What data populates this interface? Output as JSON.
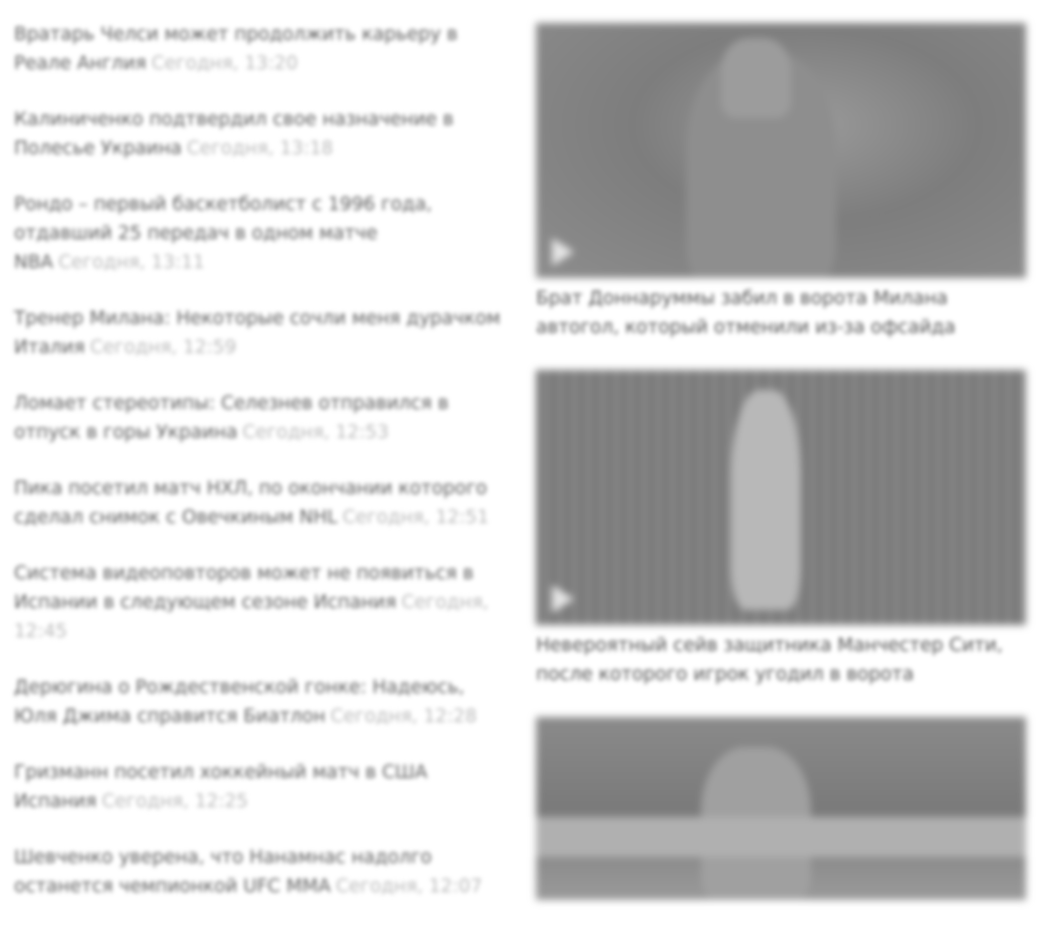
{
  "news": [
    {
      "headline": "Вратарь Челси может продолжить карьеру в Реале Англия",
      "time": "Сегодня, 13:20"
    },
    {
      "headline": "Калиниченко подтвердил свое назначение в Полесье Украина",
      "time": "Сегодня, 13:18"
    },
    {
      "headline": "Рондо – первый баскетболист с 1996 года, отдавший 25 передач в одном матче NBA",
      "time": "Сегодня, 13:11"
    },
    {
      "headline": "Тренер Милана: Некоторые сочли меня дурачком Италия",
      "time": "Сегодня, 12:59"
    },
    {
      "headline": "Ломает стереотипы: Селезнев отправился в отпуск в горы Украина",
      "time": "Сегодня, 12:53"
    },
    {
      "headline": "Пика посетил матч НХЛ, по окончании которого сделал снимок с Овечкиным NHL",
      "time": "Сегодня, 12:51"
    },
    {
      "headline": "Система видеоповторов может не появиться в Испании в следующем сезоне Испания",
      "time": "Сегодня, 12:45"
    },
    {
      "headline": "Дерюгина о Рождественской гонке: Надеюсь, Юля Джима справится Биатлон",
      "time": "Сегодня, 12:28"
    },
    {
      "headline": "Гризманн посетил хоккейный матч в США Испания",
      "time": "Сегодня, 12:25"
    },
    {
      "headline": "Шевченко уверена, что Нанамнас надолго останется чемпионкой UFC ММА",
      "time": "Сегодня, 12:07"
    }
  ],
  "videos": [
    {
      "caption": "Брат Доннаруммы забил в ворота Милана автогол, который отменили из-за офсайда",
      "icon": "play-icon"
    },
    {
      "caption": "Невероятный сейв защитника Манчестер Сити, после которого игрок угодил в ворота",
      "icon": "play-icon"
    },
    {
      "caption": "",
      "icon": ""
    }
  ]
}
